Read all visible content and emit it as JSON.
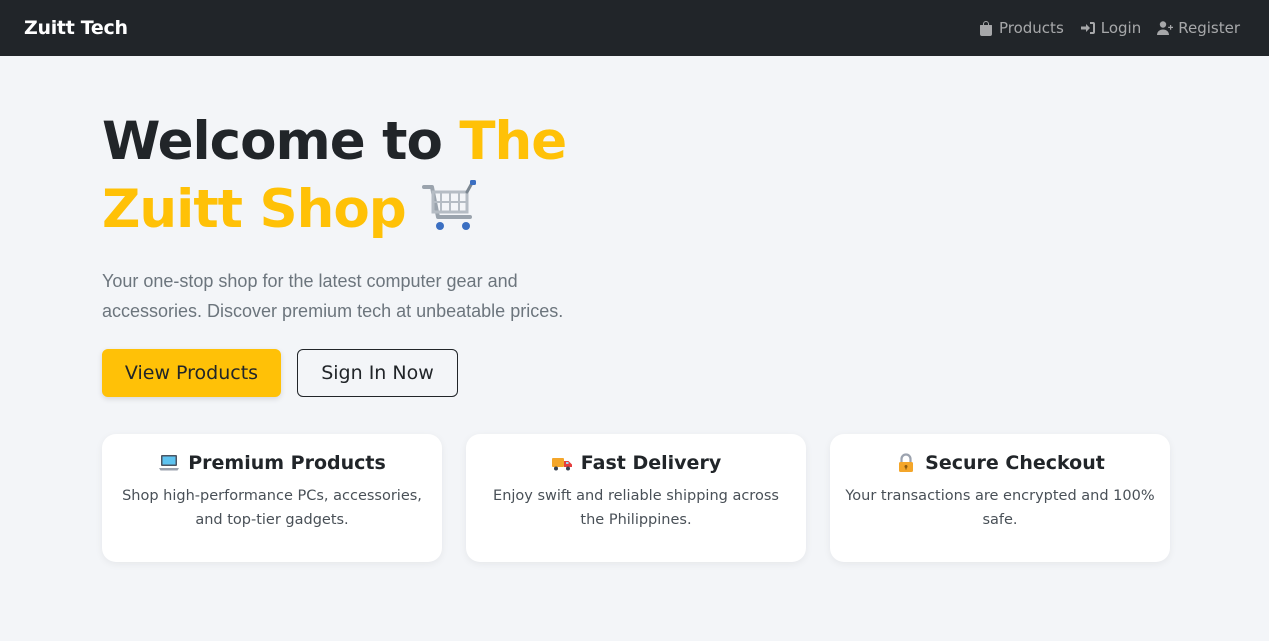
{
  "navbar": {
    "brand": "Zuitt Tech",
    "links": [
      {
        "label": "Products",
        "icon": "shopping-bag-icon"
      },
      {
        "label": "Login",
        "icon": "sign-in-icon"
      },
      {
        "label": "Register",
        "icon": "user-plus-icon"
      }
    ]
  },
  "hero": {
    "title_part1": "Welcome to ",
    "title_accent_line1": "The",
    "title_accent_line2": "Zuitt Shop",
    "subtitle": "Your one-stop shop for the latest computer gear and accessories. Discover premium tech at unbeatable prices.",
    "primary_button": "View Products",
    "secondary_button": "Sign In Now"
  },
  "features": [
    {
      "title": "Premium Products",
      "text": "Shop high-performance PCs, accessories, and top-tier gadgets.",
      "icon": "laptop-icon"
    },
    {
      "title": "Fast Delivery",
      "text": "Enjoy swift and reliable shipping across the Philippines.",
      "icon": "delivery-truck-icon"
    },
    {
      "title": "Secure Checkout",
      "text": "Your transactions are encrypted and 100% safe.",
      "icon": "padlock-icon"
    }
  ],
  "colors": {
    "navbar_bg": "#212529",
    "accent": "#ffc107",
    "page_bg": "#f3f5f8",
    "card_bg": "#ffffff"
  }
}
